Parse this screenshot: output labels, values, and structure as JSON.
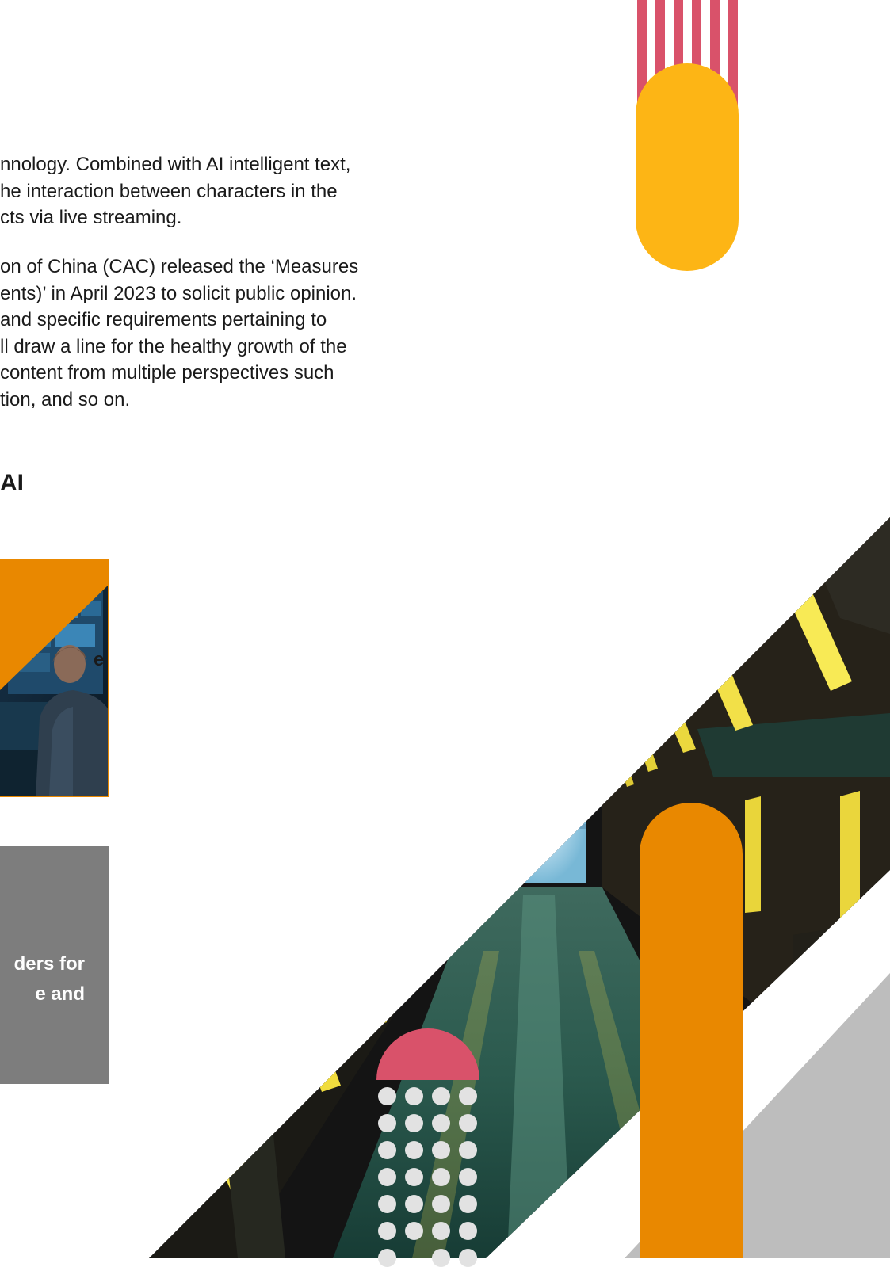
{
  "paragraph_1": [
    "nnology. Combined with AI intelligent text,",
    "he interaction between characters in the",
    "cts via live streaming."
  ],
  "paragraph_2": [
    "on of China (CAC) released the ‘Measures",
    "ents)’ in April 2023 to solicit public opinion.",
    "and specific requirements pertaining to",
    "ll draw a line for the healthy growth of the",
    "content from multiple perspectives such",
    "tion, and so on."
  ],
  "heading": "AI",
  "photo_card": {
    "text": "e"
  },
  "grey_card": {
    "lines": [
      "ders for",
      "e and"
    ]
  },
  "colors": {
    "accent_pink": "#d9526a",
    "accent_yellow": "#fdb515",
    "accent_orange": "#e98800",
    "card_grey": "#7d7d7d",
    "light_grey": "#bdbdbd"
  }
}
